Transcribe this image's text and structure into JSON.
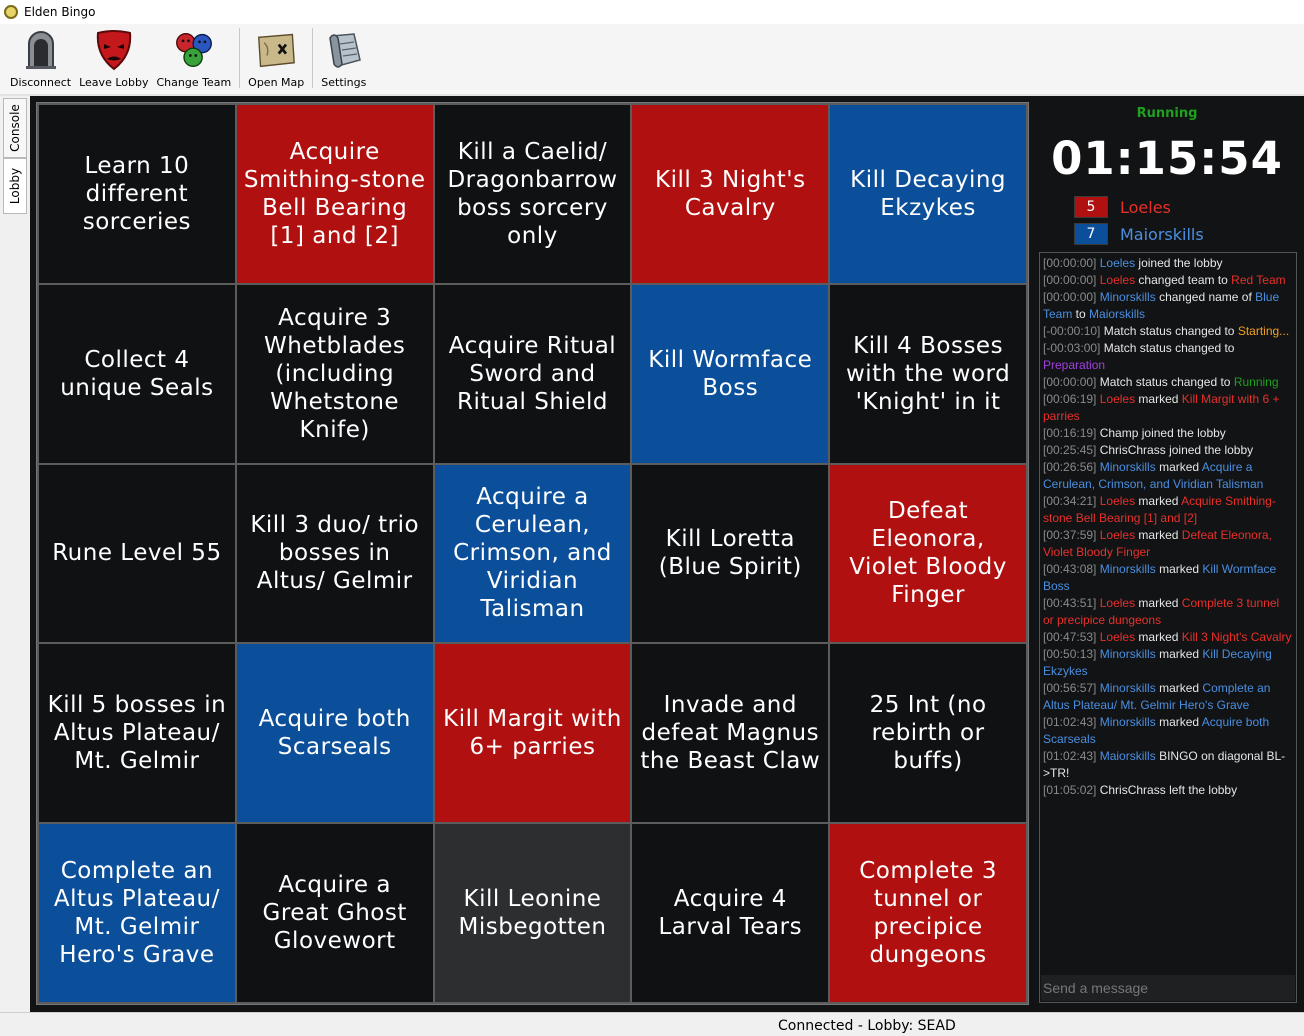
{
  "window": {
    "title": "Elden Bingo"
  },
  "toolbar": {
    "items": [
      {
        "label": "Disconnect",
        "icon": "tombstone-icon"
      },
      {
        "label": "Leave Lobby",
        "icon": "red-mask-icon"
      },
      {
        "label": "Change Team",
        "icon": "team-faces-icon"
      },
      {
        "label": "Open Map",
        "icon": "map-icon"
      },
      {
        "label": "Settings",
        "icon": "scroll-icon"
      }
    ]
  },
  "sidetabs": {
    "console": "Console",
    "lobby": "Lobby"
  },
  "board": {
    "cells": [
      {
        "text": "Learn 10 different sorceries",
        "team": "none"
      },
      {
        "text": "Acquire Smithing-stone Bell Bearing [1] and [2]",
        "team": "red"
      },
      {
        "text": "Kill a Caelid/ Dragonbarrow boss sorcery only",
        "team": "none"
      },
      {
        "text": "Kill 3 Night's Cavalry",
        "team": "red"
      },
      {
        "text": "Kill Decaying Ekzykes",
        "team": "blue"
      },
      {
        "text": "Collect 4 unique Seals",
        "team": "none"
      },
      {
        "text": "Acquire 3 Whetblades (including Whetstone Knife)",
        "team": "none"
      },
      {
        "text": "Acquire Ritual Sword and Ritual Shield",
        "team": "none"
      },
      {
        "text": "Kill Wormface Boss",
        "team": "blue"
      },
      {
        "text": "Kill 4 Bosses with the word 'Knight' in it",
        "team": "none"
      },
      {
        "text": "Rune Level 55",
        "team": "none"
      },
      {
        "text": "Kill 3 duo/ trio bosses in Altus/ Gelmir",
        "team": "none"
      },
      {
        "text": "Acquire a Cerulean, Crimson, and Viridian Talisman",
        "team": "blue"
      },
      {
        "text": "Kill Loretta (Blue Spirit)",
        "team": "none"
      },
      {
        "text": "Defeat Eleonora, Violet Bloody Finger",
        "team": "red"
      },
      {
        "text": "Kill 5 bosses in Altus Plateau/ Mt. Gelmir",
        "team": "none"
      },
      {
        "text": "Acquire both Scarseals",
        "team": "blue"
      },
      {
        "text": "Kill Margit with 6+ parries",
        "team": "red"
      },
      {
        "text": "Invade and defeat Magnus the Beast Claw",
        "team": "none"
      },
      {
        "text": "25 Int (no rebirth or buffs)",
        "team": "none"
      },
      {
        "text": "Complete an Altus Plateau/ Mt. Gelmir Hero's Grave",
        "team": "blue"
      },
      {
        "text": "Acquire a Great Ghost Glovewort",
        "team": "none"
      },
      {
        "text": "Kill Leonine Misbegotten",
        "team": "gray"
      },
      {
        "text": "Acquire 4 Larval Tears",
        "team": "none"
      },
      {
        "text": "Complete 3 tunnel or precipice dungeons",
        "team": "red"
      }
    ]
  },
  "match": {
    "status": "Running",
    "timer": "01:15:54",
    "teams": [
      {
        "score": "5",
        "name": "Loeles",
        "color": "#b0100f",
        "text_color": "#e8302a"
      },
      {
        "score": "7",
        "name": "Maiorskills",
        "color": "#0b4f9a",
        "text_color": "#4b8fe0"
      }
    ]
  },
  "colors": {
    "red": "#b0100f",
    "blue": "#0b4f9a",
    "running": "#1fa01f"
  },
  "chat": {
    "placeholder": "Send a message",
    "messages": [
      [
        {
          "t": "[00:00:00] ",
          "c": "ts"
        },
        {
          "t": "Loeles",
          "c": "c-blue"
        },
        {
          "t": " joined the lobby",
          "c": ""
        }
      ],
      [
        {
          "t": "[00:00:00] ",
          "c": "ts"
        },
        {
          "t": "Loeles",
          "c": "c-red"
        },
        {
          "t": " changed team to ",
          "c": ""
        },
        {
          "t": "Red Team",
          "c": "c-red"
        }
      ],
      [
        {
          "t": "[00:00:00] ",
          "c": "ts"
        },
        {
          "t": "Minorskills",
          "c": "c-blue"
        },
        {
          "t": " changed name of ",
          "c": ""
        },
        {
          "t": "Blue Team",
          "c": "c-blue"
        },
        {
          "t": " to ",
          "c": ""
        },
        {
          "t": "Maiorskills",
          "c": "c-blue"
        }
      ],
      [
        {
          "t": "[-00:00:10] ",
          "c": "ts"
        },
        {
          "t": "Match status changed to ",
          "c": ""
        },
        {
          "t": "Starting...",
          "c": "c-orange"
        }
      ],
      [
        {
          "t": "[-00:03:00] ",
          "c": "ts"
        },
        {
          "t": "Match status changed to ",
          "c": ""
        },
        {
          "t": "Preparation",
          "c": "c-purple"
        }
      ],
      [
        {
          "t": "[00:00:00] ",
          "c": "ts"
        },
        {
          "t": "Match status changed to ",
          "c": ""
        },
        {
          "t": "Running",
          "c": "c-green"
        }
      ],
      [
        {
          "t": "[00:06:19] ",
          "c": "ts"
        },
        {
          "t": "Loeles",
          "c": "c-red"
        },
        {
          "t": " marked ",
          "c": ""
        },
        {
          "t": "Kill Margit with 6 + parries",
          "c": "c-red"
        }
      ],
      [
        {
          "t": "[00:16:19] ",
          "c": "ts"
        },
        {
          "t": "Champ joined the lobby",
          "c": ""
        }
      ],
      [
        {
          "t": "[00:25:45] ",
          "c": "ts"
        },
        {
          "t": "ChrisChrass joined the lobby",
          "c": ""
        }
      ],
      [
        {
          "t": "[00:26:56] ",
          "c": "ts"
        },
        {
          "t": "Minorskills",
          "c": "c-blue"
        },
        {
          "t": " marked ",
          "c": ""
        },
        {
          "t": "Acquire a Cerulean, Crimson, and Viridian Talisman",
          "c": "c-blue"
        }
      ],
      [
        {
          "t": "[00:34:21] ",
          "c": "ts"
        },
        {
          "t": "Loeles",
          "c": "c-red"
        },
        {
          "t": " marked ",
          "c": ""
        },
        {
          "t": "Acquire Smithing-stone Bell Bearing [1] and [2]",
          "c": "c-red"
        }
      ],
      [
        {
          "t": "[00:37:59] ",
          "c": "ts"
        },
        {
          "t": "Loeles",
          "c": "c-red"
        },
        {
          "t": " marked ",
          "c": ""
        },
        {
          "t": "Defeat Eleonora, Violet Bloody Finger",
          "c": "c-red"
        }
      ],
      [
        {
          "t": "[00:43:08] ",
          "c": "ts"
        },
        {
          "t": "Minorskills",
          "c": "c-blue"
        },
        {
          "t": " marked ",
          "c": ""
        },
        {
          "t": "Kill Wormface Boss",
          "c": "c-blue"
        }
      ],
      [
        {
          "t": "[00:43:51] ",
          "c": "ts"
        },
        {
          "t": "Loeles",
          "c": "c-red"
        },
        {
          "t": " marked ",
          "c": ""
        },
        {
          "t": "Complete 3 tunnel or precipice dungeons",
          "c": "c-red"
        }
      ],
      [
        {
          "t": "[00:47:53] ",
          "c": "ts"
        },
        {
          "t": "Loeles",
          "c": "c-red"
        },
        {
          "t": " marked ",
          "c": ""
        },
        {
          "t": "Kill 3 Night's Cavalry",
          "c": "c-red"
        }
      ],
      [
        {
          "t": "[00:50:13] ",
          "c": "ts"
        },
        {
          "t": "Minorskills",
          "c": "c-blue"
        },
        {
          "t": " marked ",
          "c": ""
        },
        {
          "t": "Kill Decaying Ekzykes",
          "c": "c-blue"
        }
      ],
      [
        {
          "t": "[00:56:57] ",
          "c": "ts"
        },
        {
          "t": "Minorskills",
          "c": "c-blue"
        },
        {
          "t": " marked ",
          "c": ""
        },
        {
          "t": "Complete an Altus Plateau/ Mt. Gelmir Hero's Grave",
          "c": "c-blue"
        }
      ],
      [
        {
          "t": "[01:02:43] ",
          "c": "ts"
        },
        {
          "t": "Minorskills",
          "c": "c-blue"
        },
        {
          "t": " marked ",
          "c": ""
        },
        {
          "t": "Acquire both Scarseals",
          "c": "c-blue"
        }
      ],
      [
        {
          "t": "[01:02:43] ",
          "c": "ts"
        },
        {
          "t": "Maiorskills",
          "c": "c-blue"
        },
        {
          "t": " BINGO on diagonal BL->TR!",
          "c": ""
        }
      ],
      [
        {
          "t": "[01:05:02] ",
          "c": "ts"
        },
        {
          "t": "ChrisChrass left the lobby",
          "c": ""
        }
      ]
    ]
  },
  "statusbar": {
    "text": "Connected - Lobby: SEAD"
  }
}
